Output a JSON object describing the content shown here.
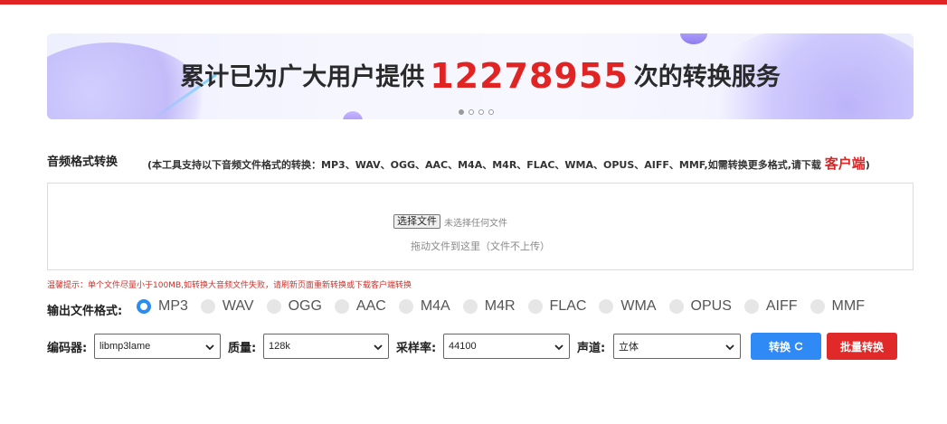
{
  "banner": {
    "prefix": "累计已为广大用户提供",
    "count": "12278955",
    "suffix": "次的转换服务",
    "carousel_dots": 4,
    "active_dot": 0
  },
  "tool": {
    "title": "音频格式转换",
    "desc_prefix": "(本工具支持以下音频文件格式的转换：MP3、WAV、OGG、AAC、M4A、M4R、FLAC、WMA、OPUS、AIFF、MMF,如需转换更多格式,请下载",
    "desc_client": "客户端",
    "desc_suffix": ")"
  },
  "upload": {
    "choose_button": "选择文件",
    "status": "未选择任何文件",
    "drag_hint": "拖动文件到这里（文件不上传）"
  },
  "warning": "温馨提示：单个文件尽量小于100MB,如转换大音频文件失败，请刷新页面重新转换或下载客户端转换",
  "output": {
    "label": "输出文件格式:",
    "formats": [
      "MP3",
      "WAV",
      "OGG",
      "AAC",
      "M4A",
      "M4R",
      "FLAC",
      "WMA",
      "OPUS",
      "AIFF",
      "MMF"
    ],
    "selected": "MP3"
  },
  "controls": {
    "encoder_label": "编码器:",
    "encoder_value": "libmp3lame",
    "quality_label": "质量:",
    "quality_value": "128k",
    "samplerate_label": "采样率:",
    "samplerate_value": "44100",
    "channel_label": "声道:",
    "channel_value": "立体",
    "convert_button": "转换",
    "batch_button": "批量转换"
  },
  "colors": {
    "accent_red": "#e02424",
    "accent_blue": "#2f8af5"
  }
}
